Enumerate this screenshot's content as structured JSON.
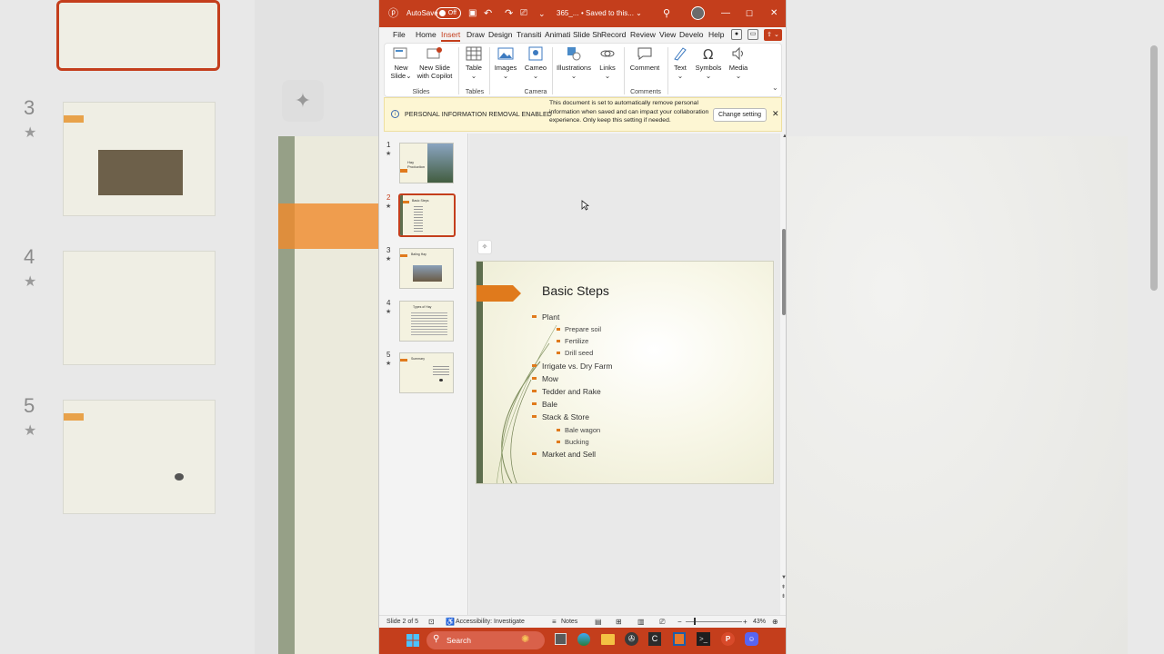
{
  "window": {
    "autosave_label": "AutoSave",
    "autosave_state": "Off",
    "filename": "365_...",
    "saved_status": "Saved to this..."
  },
  "tabs": [
    "File",
    "Home",
    "Insert",
    "Draw",
    "Design",
    "Transiti",
    "Animati",
    "Slide Sh",
    "Record",
    "Review",
    "View",
    "Develo",
    "Help"
  ],
  "active_tab": "Insert",
  "ribbon": {
    "buttons": [
      {
        "label": "New\nSlide",
        "icon": "new-slide-icon"
      },
      {
        "label": "New Slide\nwith Copilot",
        "icon": "copilot-slide-icon"
      },
      {
        "label": "Table",
        "icon": "table-icon"
      },
      {
        "label": "Images",
        "icon": "images-icon"
      },
      {
        "label": "Cameo",
        "icon": "cameo-icon"
      },
      {
        "label": "Illustrations",
        "icon": "illustrations-icon"
      },
      {
        "label": "Links",
        "icon": "links-icon"
      },
      {
        "label": "Comment",
        "icon": "comment-icon"
      },
      {
        "label": "Text",
        "icon": "text-icon"
      },
      {
        "label": "Symbols",
        "icon": "symbols-icon"
      },
      {
        "label": "Media",
        "icon": "media-icon"
      }
    ],
    "groups": [
      "Slides",
      "Tables",
      "Camera",
      "Comments"
    ]
  },
  "message_bar": {
    "title": "PERSONAL INFORMATION REMOVAL ENABLED",
    "text": "This document is set to automatically remove personal information when saved and can impact your collaboration experience. Only keep this setting if needed.",
    "button": "Change setting"
  },
  "thumbnails": [
    {
      "num": "1",
      "title": "Hay Production"
    },
    {
      "num": "2",
      "title": "Basic Steps"
    },
    {
      "num": "3",
      "title": "Baling Hay"
    },
    {
      "num": "4",
      "title": "Types of Hay"
    },
    {
      "num": "5",
      "title": "Summary"
    }
  ],
  "selected_slide": 2,
  "slide": {
    "title": "Basic Steps",
    "bullets": [
      {
        "level": 1,
        "text": "Plant"
      },
      {
        "level": 2,
        "text": "Prepare soil"
      },
      {
        "level": 2,
        "text": "Fertilize"
      },
      {
        "level": 2,
        "text": "Drill seed"
      },
      {
        "level": 1,
        "text": "Irrigate vs. Dry Farm"
      },
      {
        "level": 1,
        "text": "Mow"
      },
      {
        "level": 1,
        "text": "Tedder and Rake"
      },
      {
        "level": 1,
        "text": "Bale"
      },
      {
        "level": 1,
        "text": "Stack & Store"
      },
      {
        "level": 2,
        "text": "Bale wagon"
      },
      {
        "level": 2,
        "text": "Bucking"
      },
      {
        "level": 1,
        "text": "Market and Sell"
      }
    ]
  },
  "status": {
    "slide_info": "Slide 2 of 5",
    "accessibility": "Accessibility: Investigate",
    "notes": "Notes",
    "zoom": "43%"
  },
  "taskbar": {
    "search": "Search"
  },
  "background": {
    "numbers": [
      "3",
      "4",
      "5"
    ]
  },
  "colors": {
    "accent": "#c43e1c",
    "slide_arrow": "#e07a1c",
    "slide_bar": "#5e6e4e"
  }
}
